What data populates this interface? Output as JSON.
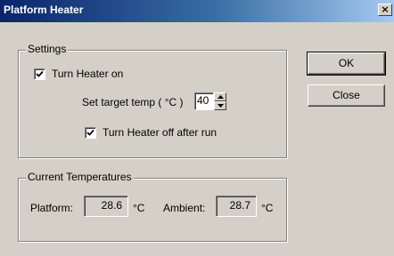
{
  "window": {
    "title": "Platform Heater",
    "close_glyph": "×"
  },
  "settings": {
    "legend": "Settings",
    "turn_heater_on_label": "Turn Heater on",
    "turn_heater_on_checked": true,
    "target_temp_label": "Set target temp ( °C )",
    "target_temp_value": "40",
    "turn_off_after_run_label": "Turn Heater off after run",
    "turn_off_after_run_checked": true
  },
  "temperatures": {
    "legend": "Current Temperatures",
    "platform_label": "Platform:",
    "platform_value": "28.6",
    "platform_unit": "°C",
    "ambient_label": "Ambient:",
    "ambient_value": "28.7",
    "ambient_unit": "°C"
  },
  "buttons": {
    "ok_label": "OK",
    "close_label": "Close"
  },
  "icons": {
    "close": "close-icon",
    "check": "checkmark-icon",
    "spin_up": "arrow-up-icon",
    "spin_down": "arrow-down-icon"
  },
  "colors": {
    "window_bg": "#d4d0c8",
    "titlebar_start": "#0a246a",
    "titlebar_end": "#a6caf0"
  }
}
